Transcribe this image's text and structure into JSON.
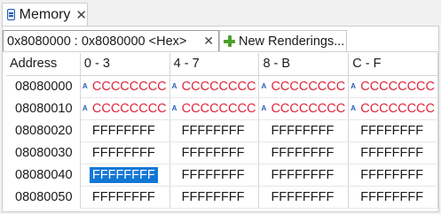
{
  "view_tab": {
    "title": "Memory",
    "close": "✕"
  },
  "rendering_tab": {
    "label": "0x8080000 : 0x8080000 <Hex>",
    "close": "✕"
  },
  "new_renderings": {
    "label": "New Renderings..."
  },
  "table": {
    "columns": [
      "Address",
      "0 - 3",
      "4 - 7",
      "8 - B",
      "C - F"
    ],
    "rows": [
      {
        "address": "08080000",
        "values": [
          "CCCCCCCC",
          "CCCCCCCC",
          "CCCCCCCC",
          "CCCCCCCC"
        ]
      },
      {
        "address": "08080010",
        "values": [
          "CCCCCCCC",
          "CCCCCCCC",
          "CCCCCCCC",
          "CCCCCCCC"
        ]
      },
      {
        "address": "08080020",
        "values": [
          "FFFFFFFF",
          "FFFFFFFF",
          "FFFFFFFF",
          "FFFFFFFF"
        ]
      },
      {
        "address": "08080030",
        "values": [
          "FFFFFFFF",
          "FFFFFFFF",
          "FFFFFFFF",
          "FFFFFFFF"
        ]
      },
      {
        "address": "08080040",
        "values": [
          "FFFFFFFF",
          "FFFFFFFF",
          "FFFFFFFF",
          "FFFFFFFF"
        ]
      },
      {
        "address": "08080050",
        "values": [
          "FFFFFFFF",
          "FFFFFFFF",
          "FFFFFFFF",
          "FFFFFFFF"
        ]
      }
    ],
    "changed_marker": "A"
  },
  "colors": {
    "changed": "#e0243a",
    "selection": "#1377d6",
    "accent": "#2a5db0"
  }
}
